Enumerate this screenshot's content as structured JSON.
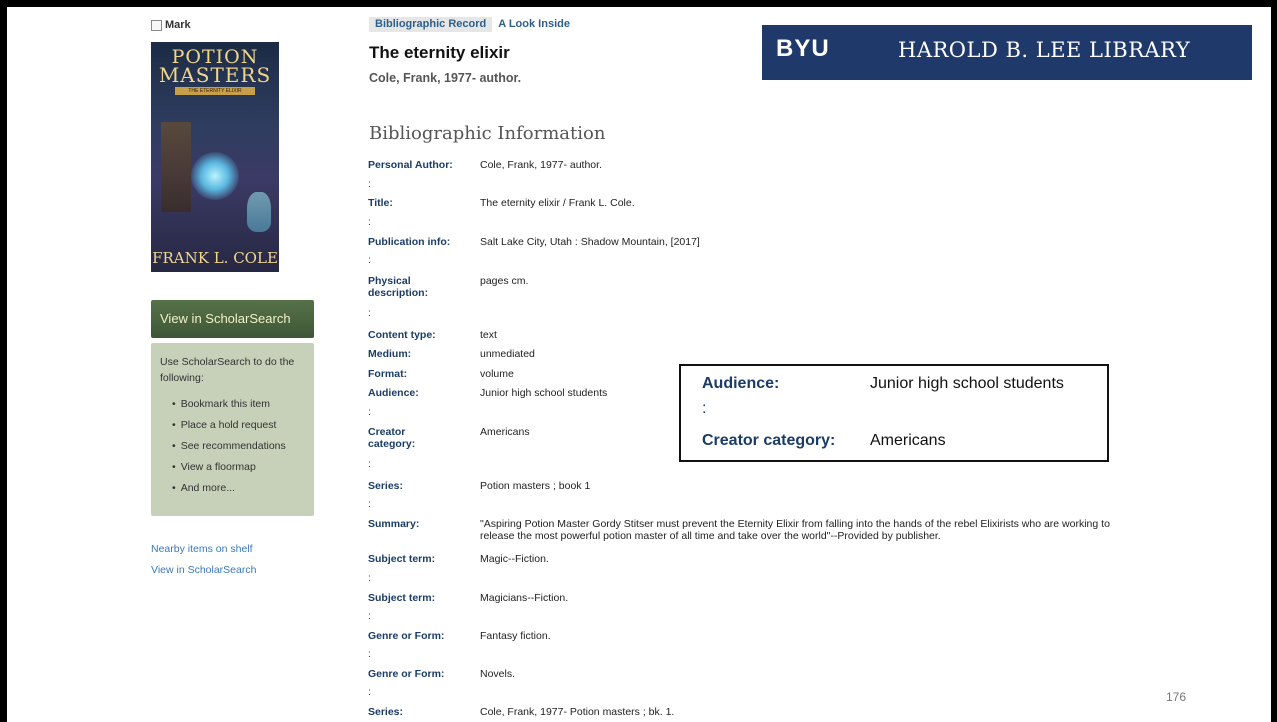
{
  "mark_label": "Mark",
  "cover": {
    "title_line1": "POTION",
    "title_line2": "MASTERS",
    "subtitle": "THE ETERNITY ELIXIR",
    "author": "FRANK L. COLE"
  },
  "sidebar": {
    "scholar_button": "View in ScholarSearch",
    "scholar_intro": "Use ScholarSearch to do the following:",
    "scholar_items": [
      "Bookmark this item",
      "Place a hold request",
      "See recommendations",
      "View a floormap",
      "And more..."
    ],
    "links": [
      "Nearby items on shelf",
      "View in ScholarSearch"
    ]
  },
  "tabs": [
    "Bibliographic Record",
    "A Look Inside"
  ],
  "record": {
    "title": "The eternity elixir",
    "author": "Cole, Frank, 1977- author."
  },
  "banner": {
    "mark": "BYU",
    "library": "HAROLD B. LEE LIBRARY"
  },
  "section_heading": "Bibliographic Information",
  "fields": [
    {
      "label": "Personal Author:",
      "value": "Cole, Frank, 1977- author."
    },
    {
      "label": "Title:",
      "value": "The eternity elixir / Frank L. Cole."
    },
    {
      "label": "Publication info:",
      "value": "Salt Lake City, Utah : Shadow Mountain, [2017]"
    },
    {
      "label": "Physical description:",
      "value": "pages cm."
    },
    {
      "label": "Content type:",
      "value": "text"
    },
    {
      "label": "Medium:",
      "value": "unmediated"
    },
    {
      "label": "Format:",
      "value": "volume"
    },
    {
      "label": "Audience:",
      "value": "Junior high school students"
    },
    {
      "label": "Creator category:",
      "value": "Americans"
    },
    {
      "label": "Series:",
      "value": "Potion masters ; book 1"
    },
    {
      "label": "Summary:",
      "value": "\"Aspiring Potion Master Gordy Stitser must prevent the Eternity Elixir from falling into the hands of the rebel Elixirists who are working to release the most powerful potion master of all time and take over the world\"--Provided by publisher."
    },
    {
      "label": "Subject term:",
      "value": "Magic--Fiction."
    },
    {
      "label": "Subject term:",
      "value": "Magicians--Fiction."
    },
    {
      "label": "Genre or Form:",
      "value": "Fantasy fiction."
    },
    {
      "label": "Genre or Form:",
      "value": "Novels."
    },
    {
      "label": "Series:",
      "value": "Cole, Frank, 1977- Potion masters ; bk. 1."
    }
  ],
  "colon": ":",
  "callout": {
    "audience_label": "Audience:",
    "audience_value": "Junior high school students",
    "colon": ":",
    "creator_label": "Creator category:",
    "creator_value": "Americans"
  },
  "page_number": "176"
}
